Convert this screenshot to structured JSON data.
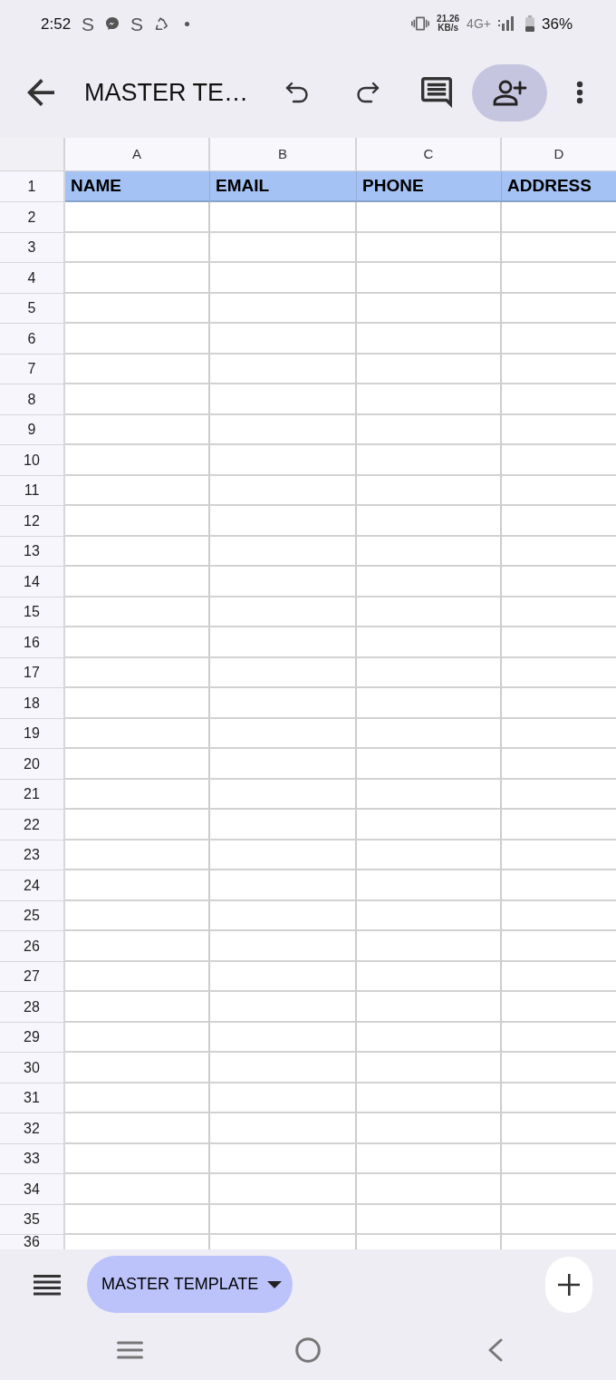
{
  "status_bar": {
    "time": "2:52",
    "notifications": [
      {
        "kind": "letter",
        "text": "S"
      },
      {
        "kind": "messenger"
      },
      {
        "kind": "letter",
        "text": "S"
      },
      {
        "kind": "recycle"
      },
      {
        "kind": "dot"
      }
    ],
    "speed": "21.26",
    "speed_unit": "KB/s",
    "network": "4G+",
    "battery": "36%"
  },
  "toolbar": {
    "title": "MASTER TE…"
  },
  "sheet": {
    "columns": [
      "A",
      "B",
      "C",
      "D"
    ],
    "rows": [
      {
        "number": "1",
        "kind": "header",
        "cells": [
          "NAME",
          "EMAIL",
          "PHONE",
          "ADDRESS"
        ]
      },
      {
        "number": "2",
        "kind": "blank"
      },
      {
        "number": "3",
        "kind": "blank"
      },
      {
        "number": "4",
        "kind": "blank"
      },
      {
        "number": "5",
        "kind": "blank"
      },
      {
        "number": "6",
        "kind": "blank"
      },
      {
        "number": "7",
        "kind": "blank"
      },
      {
        "number": "8",
        "kind": "blank"
      },
      {
        "number": "9",
        "kind": "blank"
      },
      {
        "number": "10",
        "kind": "blank"
      },
      {
        "number": "11",
        "kind": "blank"
      },
      {
        "number": "12",
        "kind": "blank"
      },
      {
        "number": "13",
        "kind": "blank"
      },
      {
        "number": "14",
        "kind": "blank"
      },
      {
        "number": "15",
        "kind": "blank"
      },
      {
        "number": "16",
        "kind": "blank"
      },
      {
        "number": "17",
        "kind": "blank"
      },
      {
        "number": "18",
        "kind": "blank"
      },
      {
        "number": "19",
        "kind": "blank"
      },
      {
        "number": "20",
        "kind": "blank"
      },
      {
        "number": "21",
        "kind": "blank"
      },
      {
        "number": "22",
        "kind": "blank"
      },
      {
        "number": "23",
        "kind": "blank"
      },
      {
        "number": "24",
        "kind": "blank"
      },
      {
        "number": "25",
        "kind": "blank"
      },
      {
        "number": "26",
        "kind": "blank"
      },
      {
        "number": "27",
        "kind": "blank"
      },
      {
        "number": "28",
        "kind": "blank"
      },
      {
        "number": "29",
        "kind": "blank"
      },
      {
        "number": "30",
        "kind": "blank"
      },
      {
        "number": "31",
        "kind": "blank"
      },
      {
        "number": "32",
        "kind": "blank"
      },
      {
        "number": "33",
        "kind": "blank"
      },
      {
        "number": "34",
        "kind": "blank"
      },
      {
        "number": "35",
        "kind": "blank"
      },
      {
        "number": "36",
        "kind": "blank"
      }
    ]
  },
  "sheet_tabs": [
    {
      "label": "MASTER TEMPLATE",
      "selected": true
    }
  ]
}
